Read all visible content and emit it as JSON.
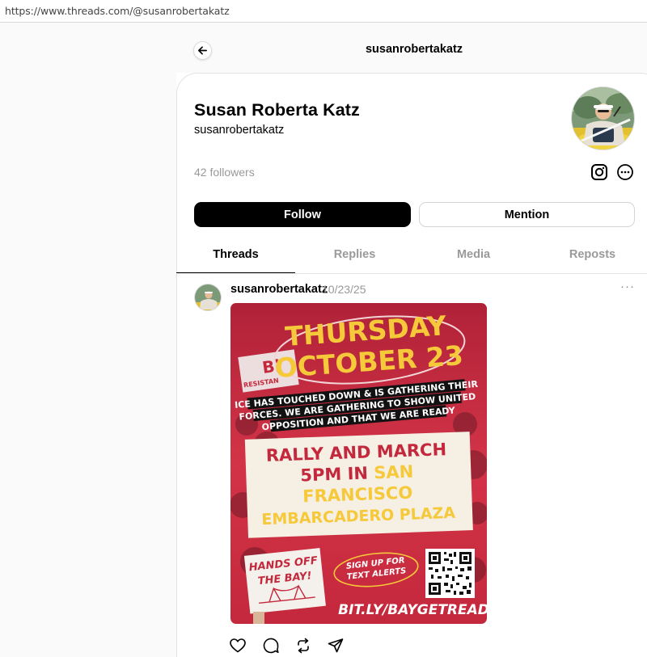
{
  "browser": {
    "url": "https://www.threads.com/@susanrobertakatz"
  },
  "header": {
    "username": "susanrobertakatz"
  },
  "profile": {
    "display_name": "Susan Roberta Katz",
    "handle": "susanrobertakatz",
    "followers": "42 followers",
    "follow_label": "Follow",
    "mention_label": "Mention"
  },
  "tabs": [
    {
      "label": "Threads",
      "active": true
    },
    {
      "label": "Replies",
      "active": false
    },
    {
      "label": "Media",
      "active": false
    },
    {
      "label": "Reposts",
      "active": false
    }
  ],
  "post": {
    "author": "susanrobertakatz",
    "date": "10/23/25",
    "more": "···",
    "poster": {
      "day": "THURSDAY",
      "date": "OCTOBER 23",
      "banner_line1": "ICE HAS TOUCHED DOWN & IS GATHERING THEIR",
      "banner_line2": "FORCES. WE ARE GATHERING TO SHOW UNITED",
      "banner_line3": "OPPOSITION AND THAT WE ARE READY",
      "rally_line1": "RALLY AND MARCH",
      "rally_line2_a": "5PM IN ",
      "rally_line2_b": "SAN",
      "rally_line3": "FRANCISCO",
      "rally_line4": "EMBARCADERO PLAZA",
      "sign_line1": "HANDS OFF",
      "sign_line2": "THE BAY!",
      "signup_line1": "SIGN UP FOR",
      "signup_line2": "TEXT ALERTS",
      "link": "BIT.LY/BAYGETREADY",
      "bg_sign_text1": "Bl",
      "bg_sign_text2": "RESISTAN"
    }
  },
  "colors": {
    "poster_red": "#c8283c",
    "poster_yellow": "#f5c93a",
    "follow_bg": "#000000"
  },
  "icons": [
    "back-arrow-icon",
    "instagram-icon",
    "more-circle-icon",
    "heart-icon",
    "comment-icon",
    "repost-icon",
    "share-icon"
  ]
}
